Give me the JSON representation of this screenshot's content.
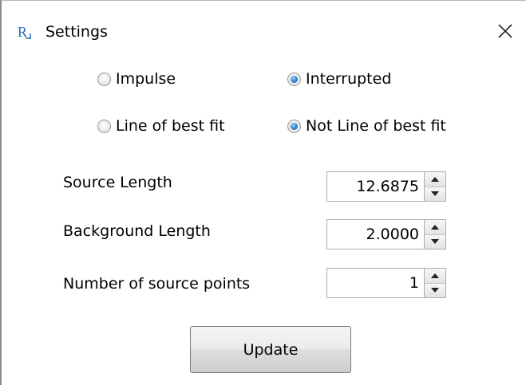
{
  "window": {
    "title": "Settings",
    "app_icon_text": "R"
  },
  "options": {
    "impulse": {
      "label": "Impulse",
      "checked": false
    },
    "interrupted": {
      "label": "Interrupted",
      "checked": true
    },
    "line_of_best_fit": {
      "label": "Line of best fit",
      "checked": false
    },
    "not_line_of_best_fit": {
      "label": "Not Line of best fit",
      "checked": true
    }
  },
  "fields": {
    "source_length": {
      "label": "Source Length",
      "value": "12.6875"
    },
    "background_length": {
      "label": "Background Length",
      "value": "2.0000"
    },
    "source_points": {
      "label": "Number of source points",
      "value": "1"
    }
  },
  "actions": {
    "update_label": "Update"
  },
  "colors": {
    "radio_selected": "#3b8fd6",
    "app_icon": "#2a6cb5"
  }
}
